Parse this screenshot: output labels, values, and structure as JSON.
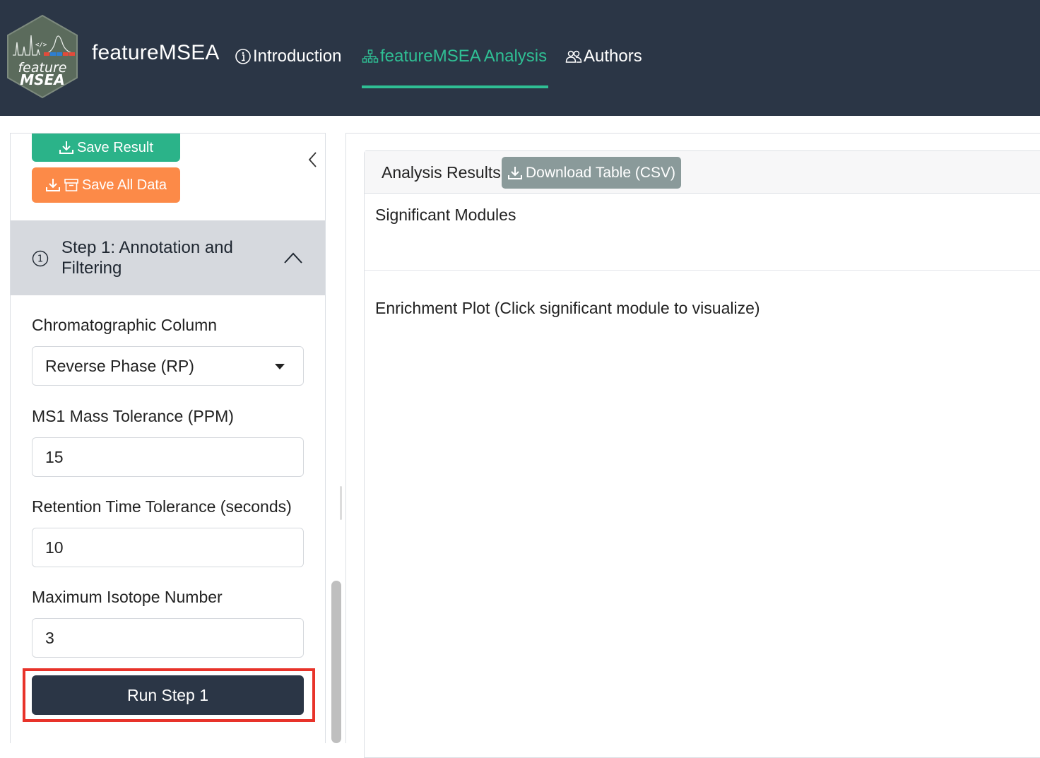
{
  "app": {
    "brand": "featureMSEA",
    "logo_text_top": "feature",
    "logo_text_bottom": "MSEA",
    "accent_color": "#2fbf94",
    "navbar_color": "#2b3646"
  },
  "nav": {
    "items": [
      {
        "label": "Introduction",
        "icon": "info-circle-icon"
      },
      {
        "label": "featureMSEA Analysis",
        "icon": "diagram-icon",
        "active": true
      },
      {
        "label": "Authors",
        "icon": "people-icon"
      }
    ]
  },
  "sidebar": {
    "save_result_label": "Save Result",
    "save_all_label": "Save All Data",
    "step": {
      "number": "1",
      "title": "Step 1: Annotation and Filtering"
    },
    "fields": {
      "column_label": "Chromatographic Column",
      "column_value": "Reverse Phase (RP)",
      "ms1_label": "MS1 Mass Tolerance (PPM)",
      "ms1_value": "15",
      "rt_label": "Retention Time Tolerance (seconds)",
      "rt_value": "10",
      "isotope_label": "Maximum Isotope Number",
      "isotope_value": "3"
    },
    "run_label": "Run Step 1"
  },
  "main": {
    "card_title": "Analysis Results",
    "download_label": "Download Table (CSV)",
    "significant_title": "Significant Modules",
    "enrichment_title": "Enrichment Plot (Click significant module to visualize)"
  }
}
